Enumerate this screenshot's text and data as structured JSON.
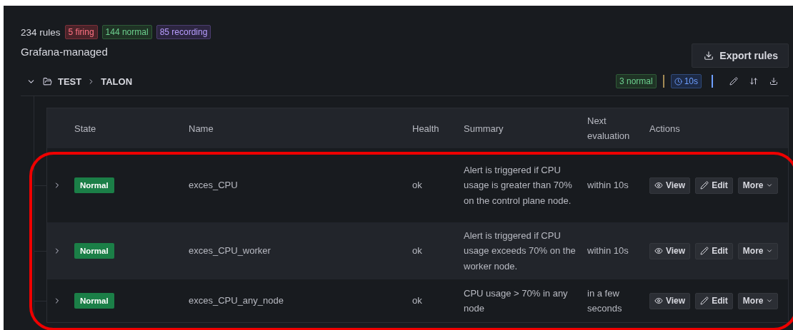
{
  "summary": {
    "total": "234 rules",
    "badges": [
      {
        "label": "5 firing",
        "kind": "firing"
      },
      {
        "label": "144 normal",
        "kind": "normal"
      },
      {
        "label": "85 recording",
        "kind": "recording"
      }
    ]
  },
  "section_title": "Grafana-managed",
  "export_button": {
    "label": "Export rules"
  },
  "group": {
    "expanded": true,
    "path": [
      "TEST",
      "TALON"
    ],
    "badges": [
      {
        "label": "3 normal",
        "kind": "normal"
      },
      {
        "label": "10s",
        "kind": "interval"
      }
    ]
  },
  "table": {
    "columns": [
      "State",
      "Name",
      "Health",
      "Summary",
      "Next evaluation",
      "Actions"
    ],
    "rows": [
      {
        "expanded": false,
        "state": "Normal",
        "name": "exces_CPU",
        "health": "ok",
        "summary": "Alert is triggered if CPU usage is greater than 70% on the control plane node.",
        "next_evaluation": "within 10s",
        "actions": [
          {
            "label": "View",
            "kind": "view"
          },
          {
            "label": "Edit",
            "kind": "edit"
          },
          {
            "label": "More",
            "kind": "more"
          }
        ]
      },
      {
        "expanded": false,
        "state": "Normal",
        "name": "exces_CPU_worker",
        "health": "ok",
        "summary": "Alert is triggered if CPU usage exceeds 70% on the worker node.",
        "next_evaluation": "within 10s",
        "actions": [
          {
            "label": "View",
            "kind": "view"
          },
          {
            "label": "Edit",
            "kind": "edit"
          },
          {
            "label": "More",
            "kind": "more"
          }
        ]
      },
      {
        "expanded": false,
        "state": "Normal",
        "name": "exces_CPU_any_node",
        "health": "ok",
        "summary": "CPU usage > 70% in any node",
        "next_evaluation": "in a few seconds",
        "actions": [
          {
            "label": "View",
            "kind": "view"
          },
          {
            "label": "Edit",
            "kind": "edit"
          },
          {
            "label": "More",
            "kind": "more"
          }
        ]
      }
    ]
  }
}
